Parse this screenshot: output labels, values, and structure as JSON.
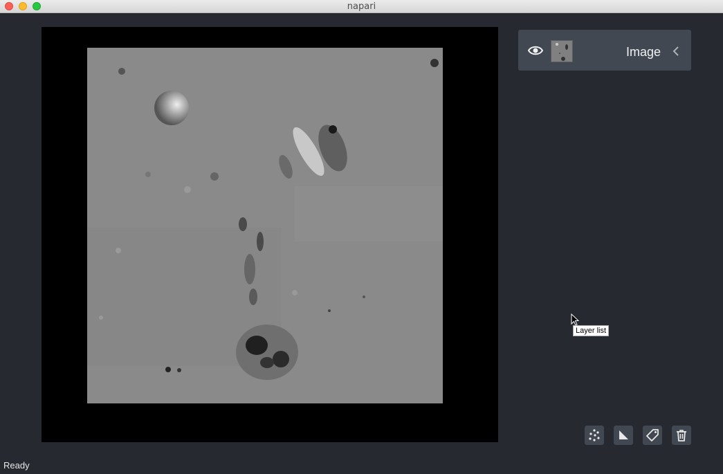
{
  "window": {
    "title": "napari"
  },
  "layers": [
    {
      "name": "Image",
      "visible": true
    }
  ],
  "tooltip": {
    "text": "Layer list"
  },
  "toolbar": {
    "buttons": [
      {
        "icon": "new-points-icon"
      },
      {
        "icon": "new-shapes-icon"
      },
      {
        "icon": "new-labels-icon"
      },
      {
        "icon": "delete-layer-icon"
      }
    ]
  },
  "status": {
    "text": "Ready"
  },
  "colors": {
    "background": "#262930",
    "panel": "#414851",
    "canvas": "#000000",
    "text": "#f0f1f2"
  }
}
